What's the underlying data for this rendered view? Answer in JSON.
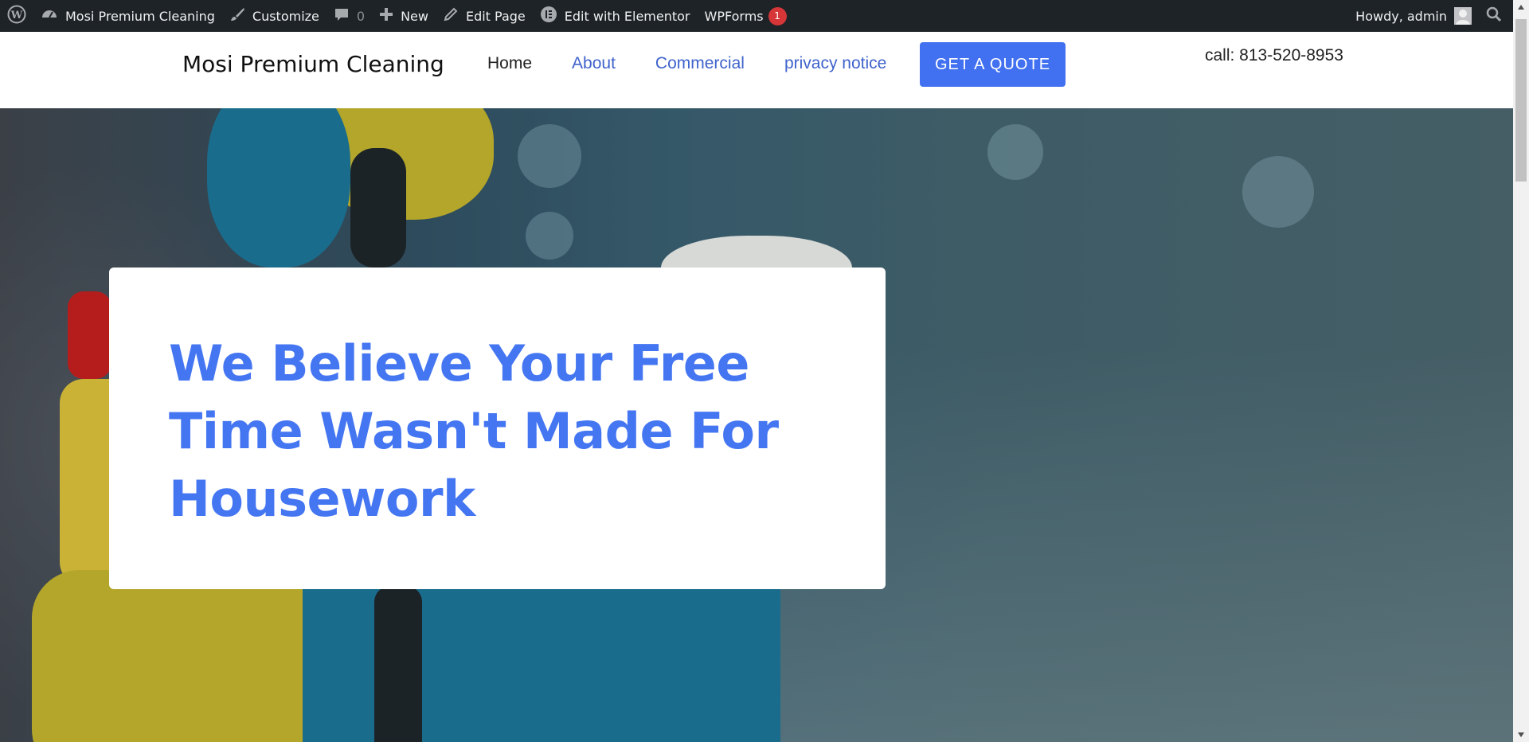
{
  "adminbar": {
    "site_name": "Mosi Premium Cleaning",
    "customize": "Customize",
    "comments_count": "0",
    "new": "New",
    "edit_page": "Edit Page",
    "edit_elementor": "Edit with Elementor",
    "wpforms": "WPForms",
    "wpforms_badge": "1",
    "howdy": "Howdy, admin"
  },
  "header": {
    "site_title": "Mosi Premium Cleaning",
    "nav": [
      "Home",
      "About",
      "Commercial",
      "privacy notice"
    ],
    "cta": "GET A QUOTE",
    "phone": "call: 813-520-8953"
  },
  "hero": {
    "headline": "We Believe Your Free Time Wasn't Made For Housework"
  },
  "colors": {
    "accent": "#4576f2",
    "admin_bar": "#1d2327",
    "badge": "#d63638"
  }
}
